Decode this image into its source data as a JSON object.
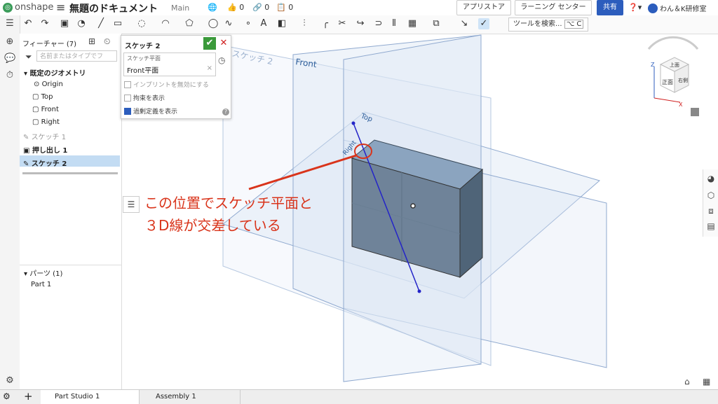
{
  "header": {
    "app_name": "onshape",
    "doc_title": "無題のドキュメント",
    "branch": "Main",
    "likes": "0",
    "links": "0",
    "copies": "0",
    "appstore_btn": "アプリストア",
    "learning_btn": "ラーニング センター",
    "share_btn": "共有",
    "user_name": "わん＆K研修室"
  },
  "toolbar": {
    "tool_search": "ツールを検索...",
    "shortcut": "⌥ C"
  },
  "feature_list": {
    "title": "フィーチャー (7)",
    "filter_placeholder": "名前またはタイプでフ",
    "default_geometry": "既定のジオメトリ",
    "origin": "Origin",
    "top": "Top",
    "front": "Front",
    "right": "Right",
    "sketch1": "スケッチ 1",
    "extrude1": "押し出し 1",
    "sketch2": "スケッチ 2"
  },
  "parts": {
    "header": "パーツ (1)",
    "part1": "Part 1"
  },
  "sketch_dialog": {
    "title": "スケッチ 2",
    "plane_label": "スケッチ平面",
    "plane_value": "Front平面",
    "opt1": "インプリントを無効にする",
    "opt2": "拘束を表示",
    "opt3": "過剰定義を表示"
  },
  "viewport": {
    "plane_front": "Front",
    "plane_top": "Top",
    "plane_right": "Right",
    "plane_sketch": "スケッチ 2",
    "annotation_line1": "この位置でスケッチ平面と",
    "annotation_line2": "３D線が交差している",
    "cube_top": "上面",
    "cube_front": "正面",
    "cube_right": "右側"
  },
  "tabs": {
    "part_studio": "Part Studio 1",
    "assembly": "Assembly 1"
  }
}
